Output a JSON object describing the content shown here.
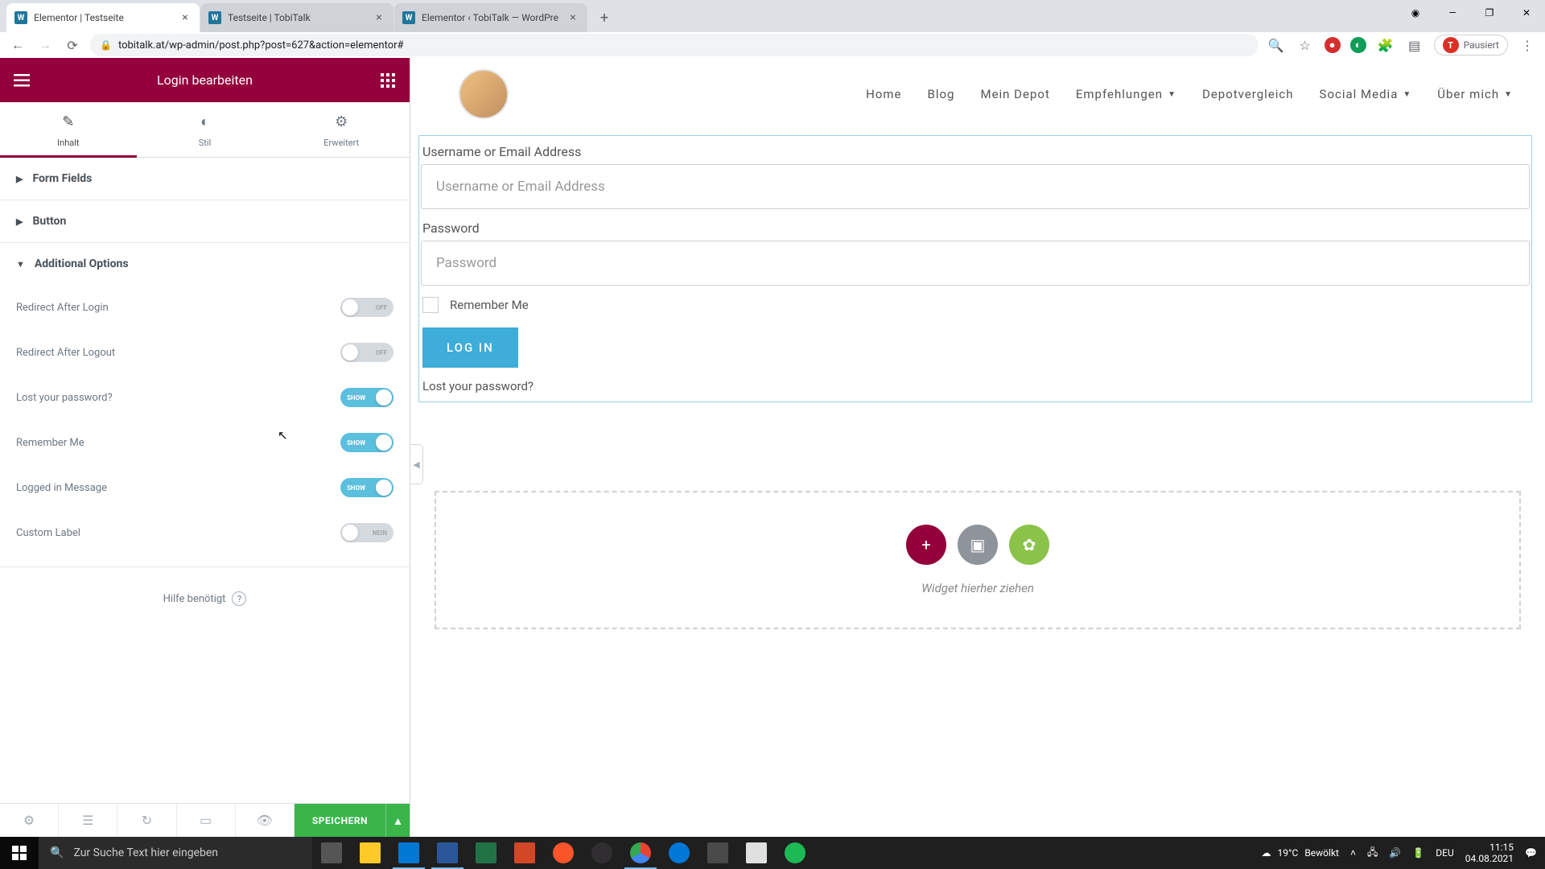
{
  "browser": {
    "tabs": [
      {
        "title": "Elementor | Testseite",
        "active": true
      },
      {
        "title": "Testseite | TobiTalk",
        "active": false
      },
      {
        "title": "Elementor ‹ TobiTalk — WordPre",
        "active": false
      }
    ],
    "url": "tobitalk.at/wp-admin/post.php?post=627&action=elementor#",
    "profile_status": "Pausiert",
    "profile_initial": "T"
  },
  "panel": {
    "title": "Login bearbeiten",
    "tabs": {
      "content": "Inhalt",
      "style": "Stil",
      "advanced": "Erweitert"
    },
    "sections": {
      "form_fields": "Form Fields",
      "button": "Button",
      "additional": "Additional Options"
    },
    "options": {
      "redirect_login": {
        "label": "Redirect After Login",
        "state": "OFF"
      },
      "redirect_logout": {
        "label": "Redirect After Logout",
        "state": "OFF"
      },
      "lost_password": {
        "label": "Lost your password?",
        "state": "SHOW"
      },
      "remember_me": {
        "label": "Remember Me",
        "state": "SHOW"
      },
      "logged_in_msg": {
        "label": "Logged in Message",
        "state": "SHOW"
      },
      "custom_label": {
        "label": "Custom Label",
        "state": "NEIN"
      }
    },
    "help": "Hilfe benötigt",
    "save": "SPEICHERN"
  },
  "site": {
    "nav": {
      "home": "Home",
      "blog": "Blog",
      "depot": "Mein Depot",
      "recs": "Empfehlungen",
      "compare": "Depotvergleich",
      "social": "Social Media",
      "about": "Über mich"
    }
  },
  "form": {
    "username_label": "Username or Email Address",
    "username_placeholder": "Username or Email Address",
    "password_label": "Password",
    "password_placeholder": "Password",
    "remember": "Remember Me",
    "submit": "LOG IN",
    "lost": "Lost your password?"
  },
  "dropzone": {
    "text": "Widget hierher ziehen"
  },
  "taskbar": {
    "search_placeholder": "Zur Suche Text hier eingeben",
    "weather_temp": "19°C",
    "weather_text": "Bewölkt",
    "lang": "DEU",
    "time": "11:15",
    "date": "04.08.2021"
  }
}
